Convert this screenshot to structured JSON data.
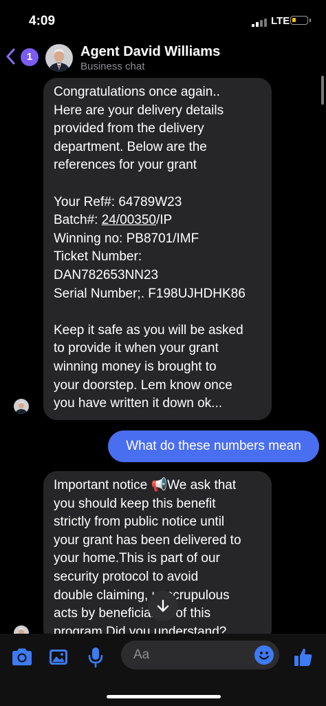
{
  "status": {
    "time": "4:09",
    "network": "LTE"
  },
  "header": {
    "unread_count": "1",
    "contact_name": "Agent David Williams",
    "subtitle": "Business chat"
  },
  "messages": {
    "first": {
      "lines": [
        "Congratulations once again..",
        "Here are your delivery details",
        "provided from the delivery",
        "department. Below are the",
        "references for your grant"
      ],
      "ref": "Your Ref#: 64789W23",
      "batch_prefix": "Batch#: ",
      "batch_link": "24/00350",
      "batch_suffix": "/IP",
      "winning": "Winning no: PB8701/IMF",
      "ticket_label": "Ticket Number:",
      "ticket_value": "DAN782653NN23",
      "serial": "Serial Number;. F198UJHDHK86",
      "closing_lines": [
        "Keep it safe as you will be asked",
        "to provide it when your grant",
        "winning money is brought to",
        "your doorstep. Lem know once",
        "you have written it down ok..."
      ]
    },
    "outgoing": "What do these numbers mean",
    "second": {
      "lines": [
        "Important notice 📢We ask that",
        "you should keep this benefit",
        "strictly from public notice until",
        "your grant has been delivered to",
        "your home.This is part of our",
        "security protocol to avoid",
        "double claiming, unscrupulous",
        "acts by beneficiaries of this",
        "program.Did you understand?"
      ]
    }
  },
  "composer": {
    "placeholder": "Aa"
  },
  "colors": {
    "accent": "#4a6ef0",
    "badge": "#7b5cf5",
    "incoming_bubble": "#262628",
    "icon_blue": "#3d7bf5"
  }
}
